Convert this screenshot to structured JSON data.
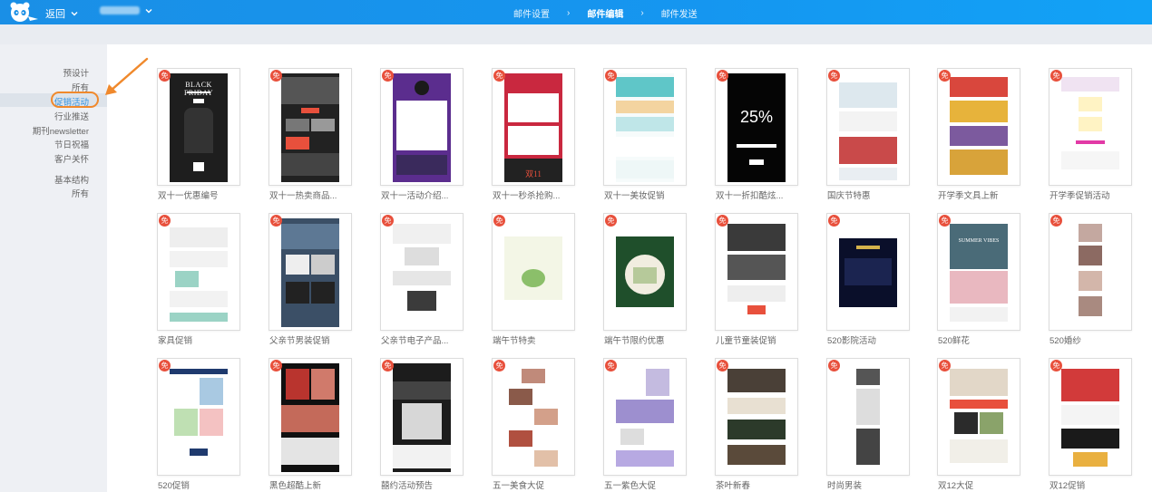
{
  "header": {
    "back_label": "返回",
    "steps": [
      "邮件设置",
      "邮件编辑",
      "邮件发送"
    ],
    "active_step": 1,
    "step_separator": "›"
  },
  "sidebar": {
    "items": [
      "预设计",
      "所有",
      "促销活动",
      "行业推送",
      "期刊newsletter",
      "节日祝福",
      "客户关怀",
      "基本结构",
      "所有"
    ],
    "active_index": 2
  },
  "badge_label": "免",
  "thumbnails": {
    "black_friday": "BLACK FRIDAY",
    "pct": "25%",
    "summer": "SUMMER VIBES",
    "double11": "双11"
  },
  "templates": [
    {
      "name": "双十一优惠编号",
      "theme": "t1"
    },
    {
      "name": "双十一热卖商品...",
      "theme": "t2"
    },
    {
      "name": "双十一活动介绍...",
      "theme": "t3"
    },
    {
      "name": "双十一秒杀抢购...",
      "theme": "t4"
    },
    {
      "name": "双十一美妆促销",
      "theme": "t5"
    },
    {
      "name": "双十一折扣酷炫...",
      "theme": "t6"
    },
    {
      "name": "国庆节特惠",
      "theme": "t7"
    },
    {
      "name": "开学季文具上新",
      "theme": "t8"
    },
    {
      "name": "开学季促销活动",
      "theme": "t9"
    },
    {
      "name": "家具促销",
      "theme": "t10"
    },
    {
      "name": "父亲节男装促销",
      "theme": "t11"
    },
    {
      "name": "父亲节电子产品...",
      "theme": "t12"
    },
    {
      "name": "端午节特卖",
      "theme": "t13"
    },
    {
      "name": "端午节限约优惠",
      "theme": "t14"
    },
    {
      "name": "儿童节童装促销",
      "theme": "t15"
    },
    {
      "name": "520影院活动",
      "theme": "t16"
    },
    {
      "name": "520鲜花",
      "theme": "t17"
    },
    {
      "name": "520婚纱",
      "theme": "t18"
    },
    {
      "name": "520促销",
      "theme": "t19"
    },
    {
      "name": "黑色超酷上新",
      "theme": "t20"
    },
    {
      "name": "囍约活动预告",
      "theme": "t21"
    },
    {
      "name": "五一美食大促",
      "theme": "t22"
    },
    {
      "name": "五一紫色大促",
      "theme": "t23"
    },
    {
      "name": "茶叶新春",
      "theme": "t24"
    },
    {
      "name": "时尚男装",
      "theme": "t25"
    },
    {
      "name": "双12大促",
      "theme": "t26"
    },
    {
      "name": "双12促销",
      "theme": "t27"
    }
  ],
  "colors": {
    "header": "#1a8fe6",
    "badge": "#e8503c",
    "active": "#2d8fe0",
    "highlight": "#f0892c"
  }
}
